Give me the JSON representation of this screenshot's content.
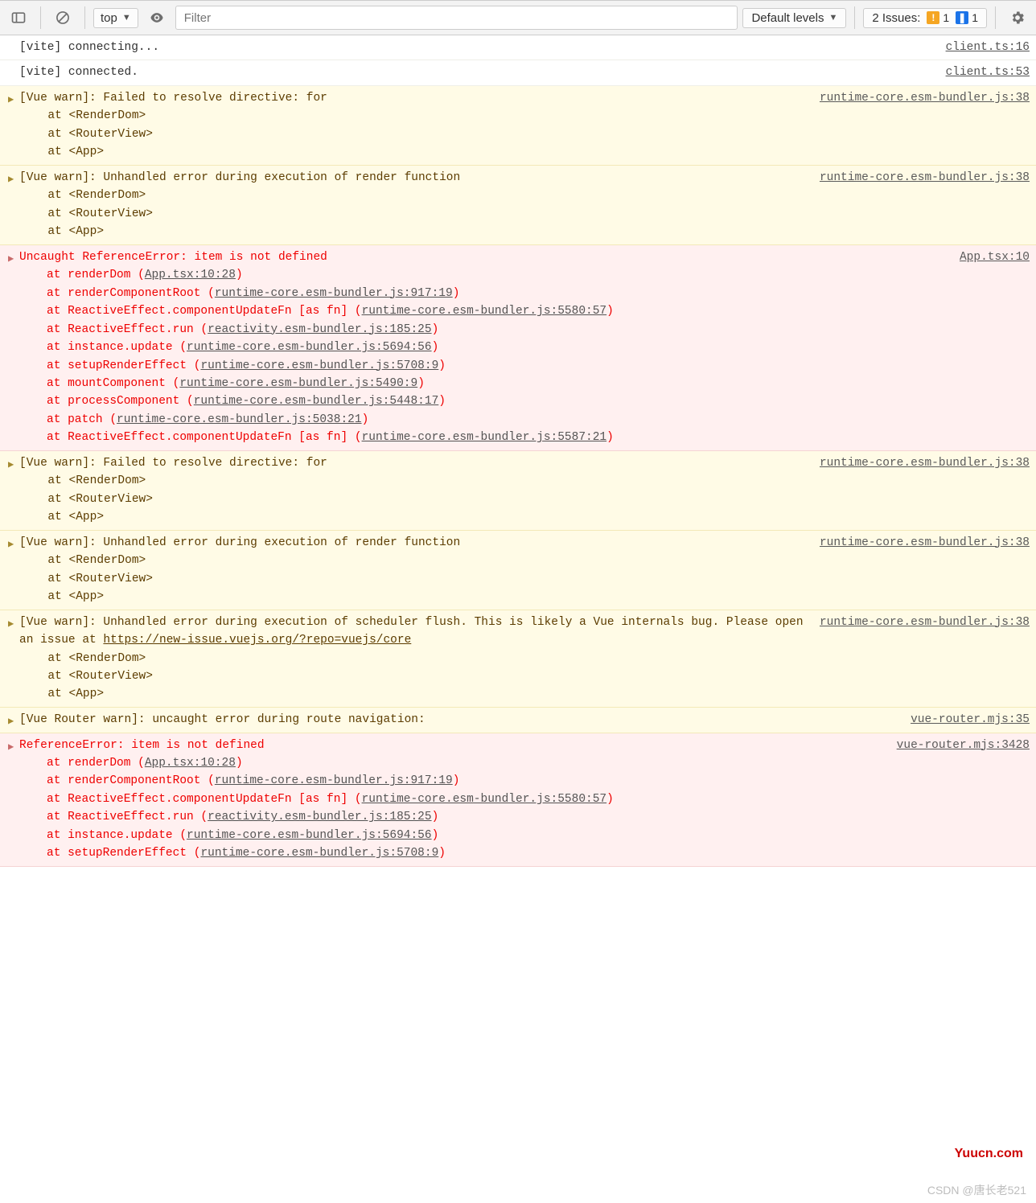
{
  "toolbar": {
    "context": "top",
    "filter_placeholder": "Filter",
    "levels": "Default levels",
    "issues_label": "2 Issues:",
    "issues_warn": "1",
    "issues_info": "1"
  },
  "watermarks": {
    "site": "Yuucn.com",
    "csdn": "CSDN @唐长老521"
  },
  "rows": [
    {
      "type": "log",
      "text": "[vite] connecting...",
      "src": "client.ts:16"
    },
    {
      "type": "log",
      "text": "[vite] connected.",
      "src": "client.ts:53"
    },
    {
      "type": "warn",
      "src": "runtime-core.esm-bundler.js:38",
      "head": "[Vue warn]: Failed to resolve directive: for ",
      "stack": [
        "  at <RenderDom>",
        "  at <RouterView>",
        "  at <App>"
      ]
    },
    {
      "type": "warn",
      "src": "runtime-core.esm-bundler.js:38",
      "head": "[Vue warn]: Unhandled error during execution of render function ",
      "stack": [
        "  at <RenderDom>",
        "  at <RouterView>",
        "  at <App>"
      ]
    },
    {
      "type": "error",
      "src": "App.tsx:10",
      "head": "Uncaught ReferenceError: item is not defined",
      "trace": [
        {
          "pre": "at renderDom (",
          "link": "App.tsx:10:28",
          "post": ")"
        },
        {
          "pre": "at renderComponentRoot (",
          "link": "runtime-core.esm-bundler.js:917:19",
          "post": ")"
        },
        {
          "pre": "at ReactiveEffect.componentUpdateFn [as fn] (",
          "link": "runtime-core.esm-bundler.js:5580:57",
          "post": ")"
        },
        {
          "pre": "at ReactiveEffect.run (",
          "link": "reactivity.esm-bundler.js:185:25",
          "post": ")"
        },
        {
          "pre": "at instance.update (",
          "link": "runtime-core.esm-bundler.js:5694:56",
          "post": ")"
        },
        {
          "pre": "at setupRenderEffect (",
          "link": "runtime-core.esm-bundler.js:5708:9",
          "post": ")"
        },
        {
          "pre": "at mountComponent (",
          "link": "runtime-core.esm-bundler.js:5490:9",
          "post": ")"
        },
        {
          "pre": "at processComponent (",
          "link": "runtime-core.esm-bundler.js:5448:17",
          "post": ")"
        },
        {
          "pre": "at patch (",
          "link": "runtime-core.esm-bundler.js:5038:21",
          "post": ")"
        },
        {
          "pre": "at ReactiveEffect.componentUpdateFn [as fn] (",
          "link": "runtime-core.esm-bundler.js:5587:21",
          "post": ")"
        }
      ]
    },
    {
      "type": "warn",
      "src": "runtime-core.esm-bundler.js:38",
      "head": "[Vue warn]: Failed to resolve directive: for ",
      "stack": [
        "  at <RenderDom>",
        "  at <RouterView>",
        "  at <App>"
      ]
    },
    {
      "type": "warn",
      "src": "runtime-core.esm-bundler.js:38",
      "head": "[Vue warn]: Unhandled error during execution of render function ",
      "stack": [
        "  at <RenderDom>",
        "  at <RouterView>",
        "  at <App>"
      ]
    },
    {
      "type": "warn",
      "src": "runtime-core.esm-bundler.js:38",
      "head_parts": {
        "p1": "[Vue warn]: Unhandled error during execution of scheduler flush. This is likely a Vue internals bug. Please open an issue at ",
        "link": "https://new-issue.vuejs.org/?repo=vuejs/core",
        "p2": " "
      },
      "stack": [
        "  at <RenderDom>",
        "  at <RouterView>",
        "  at <App>"
      ]
    },
    {
      "type": "warn",
      "src": "vue-router.mjs:35",
      "head": "[Vue Router warn]: uncaught error during route navigation:"
    },
    {
      "type": "error",
      "src": "vue-router.mjs:3428",
      "head": "ReferenceError: item is not defined",
      "trace": [
        {
          "pre": "at renderDom (",
          "link": "App.tsx:10:28",
          "post": ")"
        },
        {
          "pre": "at renderComponentRoot (",
          "link": "runtime-core.esm-bundler.js:917:19",
          "post": ")"
        },
        {
          "pre": "at ReactiveEffect.componentUpdateFn [as fn] (",
          "link": "runtime-core.esm-bundler.js:5580:57",
          "post": ")"
        },
        {
          "pre": "at ReactiveEffect.run (",
          "link": "reactivity.esm-bundler.js:185:25",
          "post": ")"
        },
        {
          "pre": "at instance.update (",
          "link": "runtime-core.esm-bundler.js:5694:56",
          "post": ")"
        },
        {
          "pre": "at setupRenderEffect (",
          "link": "runtime-core.esm-bundler.js:5708:9",
          "post": ")"
        }
      ]
    }
  ]
}
